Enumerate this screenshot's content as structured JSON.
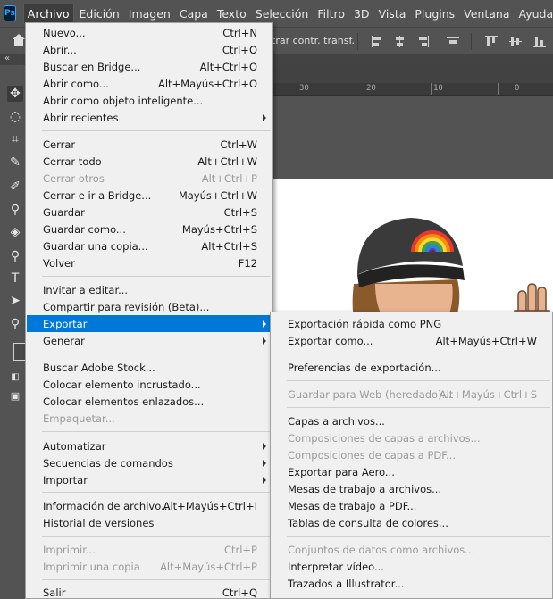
{
  "app": {
    "logo_text": "Ps"
  },
  "menubar": {
    "items": [
      "Archivo",
      "Edición",
      "Imagen",
      "Capa",
      "Texto",
      "Selección",
      "Filtro",
      "3D",
      "Vista",
      "Plugins",
      "Ventana",
      "Ayuda"
    ]
  },
  "options_bar": {
    "partial_label": "trar contr. transf."
  },
  "ruler": {
    "labels": [
      "30",
      "20",
      "10",
      "0"
    ]
  },
  "archivo_menu": {
    "items": [
      {
        "label": "Nuevo...",
        "shortcut": "Ctrl+N"
      },
      {
        "label": "Abrir...",
        "shortcut": "Ctrl+O"
      },
      {
        "label": "Buscar en Bridge...",
        "shortcut": "Alt+Ctrl+O"
      },
      {
        "label": "Abrir como...",
        "shortcut": "Alt+Mayús+Ctrl+O"
      },
      {
        "label": "Abrir como objeto inteligente...",
        "shortcut": ""
      },
      {
        "label": "Abrir recientes",
        "shortcut": "",
        "submenu": true
      },
      {
        "label": "Cerrar",
        "shortcut": "Ctrl+W"
      },
      {
        "label": "Cerrar todo",
        "shortcut": "Alt+Ctrl+W"
      },
      {
        "label": "Cerrar otros",
        "shortcut": "Alt+Ctrl+P",
        "disabled": true
      },
      {
        "label": "Cerrar e ir a Bridge...",
        "shortcut": "Mayús+Ctrl+W"
      },
      {
        "label": "Guardar",
        "shortcut": "Ctrl+S"
      },
      {
        "label": "Guardar como...",
        "shortcut": "Mayús+Ctrl+S"
      },
      {
        "label": "Guardar una copia...",
        "shortcut": "Alt+Ctrl+S"
      },
      {
        "label": "Volver",
        "shortcut": "F12"
      },
      {
        "label": "Invitar a editar...",
        "shortcut": ""
      },
      {
        "label": "Compartir para revisión (Beta)...",
        "shortcut": ""
      },
      {
        "label": "Exportar",
        "shortcut": "",
        "submenu": true,
        "highlighted": true
      },
      {
        "label": "Generar",
        "shortcut": "",
        "submenu": true
      },
      {
        "label": "Buscar Adobe Stock...",
        "shortcut": ""
      },
      {
        "label": "Colocar elemento incrustado...",
        "shortcut": ""
      },
      {
        "label": "Colocar elementos enlazados...",
        "shortcut": ""
      },
      {
        "label": "Empaquetar...",
        "shortcut": "",
        "disabled": true
      },
      {
        "label": "Automatizar",
        "shortcut": "",
        "submenu": true
      },
      {
        "label": "Secuencias de comandos",
        "shortcut": "",
        "submenu": true
      },
      {
        "label": "Importar",
        "shortcut": "",
        "submenu": true
      },
      {
        "label": "Información de archivo...",
        "shortcut": "Alt+Mayús+Ctrl+I"
      },
      {
        "label": "Historial de versiones",
        "shortcut": ""
      },
      {
        "label": "Imprimir...",
        "shortcut": "Ctrl+P",
        "disabled": true
      },
      {
        "label": "Imprimir una copia",
        "shortcut": "Alt+Mayús+Ctrl+P",
        "disabled": true
      },
      {
        "label": "Salir",
        "shortcut": "Ctrl+Q"
      }
    ]
  },
  "exportar_submenu": {
    "items": [
      {
        "label": "Exportación rápida como PNG",
        "shortcut": ""
      },
      {
        "label": "Exportar como...",
        "shortcut": "Alt+Mayús+Ctrl+W"
      },
      {
        "label": "Preferencias de exportación...",
        "shortcut": ""
      },
      {
        "label": "Guardar para Web (heredado)...",
        "shortcut": "Alt+Mayús+Ctrl+S",
        "disabled": true
      },
      {
        "label": "Capas a archivos...",
        "shortcut": ""
      },
      {
        "label": "Composiciones de capas a archivos...",
        "shortcut": "",
        "disabled": true
      },
      {
        "label": "Composiciones de capas a PDF...",
        "shortcut": "",
        "disabled": true
      },
      {
        "label": "Exportar para Aero...",
        "shortcut": ""
      },
      {
        "label": "Mesas de trabajo a archivos...",
        "shortcut": ""
      },
      {
        "label": "Mesas de trabajo a PDF...",
        "shortcut": ""
      },
      {
        "label": "Tablas de consulta de colores...",
        "shortcut": ""
      },
      {
        "label": "Conjuntos de datos como archivos...",
        "shortcut": "",
        "disabled": true
      },
      {
        "label": "Interpretar vídeo...",
        "shortcut": ""
      },
      {
        "label": "Trazados a Illustrator...",
        "shortcut": ""
      }
    ]
  },
  "colors": {
    "highlight": "#0078d7",
    "menu_bg": "#f0f0f0",
    "chrome": "#535353"
  }
}
